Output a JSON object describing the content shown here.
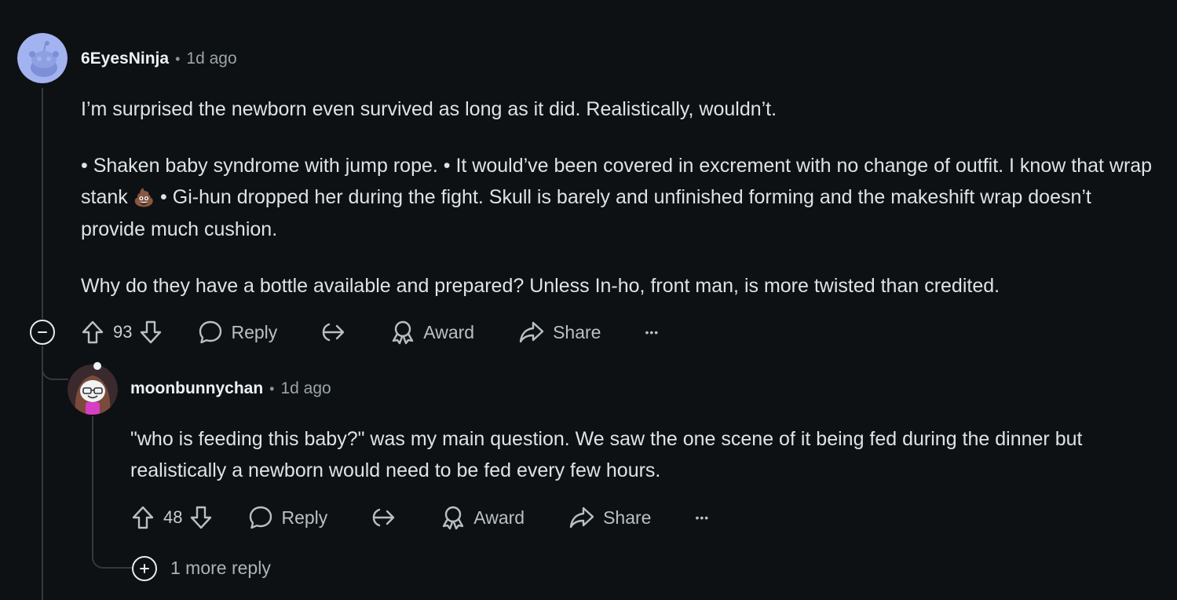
{
  "comments": [
    {
      "author": "6EyesNinja",
      "separator": "•",
      "timestamp": "1d ago",
      "body": {
        "p1": "I’m surprised the newborn even survived as long as it did. Realistically, wouldn’t.",
        "p2a": "• Shaken baby syndrome with jump rope. • It would’ve been covered in excrement with no change of outfit. I know that wrap stank ",
        "emoji": "💩",
        "p2b": " • Gi-hun dropped her during the fight. Skull is barely and unfinished forming and the makeshift wrap doesn’t provide much cushion.",
        "p3": "Why do they have a bottle available and prepared? Unless In-ho, front man, is more twisted than credited."
      },
      "score": "93",
      "actions": {
        "reply": "Reply",
        "award": "Award",
        "share": "Share",
        "more": "•••"
      }
    },
    {
      "author": "moonbunnychan",
      "separator": "•",
      "timestamp": "1d ago",
      "body": {
        "p1": "\"who is feeding this baby?\" was my main question. We saw the one scene of it being fed during the dinner but realistically a newborn would need to be fed every few hours."
      },
      "score": "48",
      "actions": {
        "reply": "Reply",
        "award": "Award",
        "share": "Share",
        "more": "•••"
      }
    }
  ],
  "more_replies": "1 more reply",
  "colors": {
    "background": "#0e1113",
    "thread_line": "#33393d",
    "text": "#dfe3e5",
    "muted": "#9aa4a9",
    "avatar1_bg": "#a3b3f0",
    "avatar2_bg": "#4a2f35"
  },
  "icons": {
    "avatar1": "snoo-avatar",
    "avatar2": "snoo-bunny-avatar",
    "upvote": "upvote-arrow-icon",
    "downvote": "downvote-arrow-icon",
    "reply": "speech-bubble-icon",
    "crosspost": "crosspost-icon",
    "award": "award-ribbon-icon",
    "share": "share-arrow-icon",
    "more": "ellipsis-icon",
    "collapse": "minus-circle-icon",
    "expand": "plus-circle-icon"
  }
}
